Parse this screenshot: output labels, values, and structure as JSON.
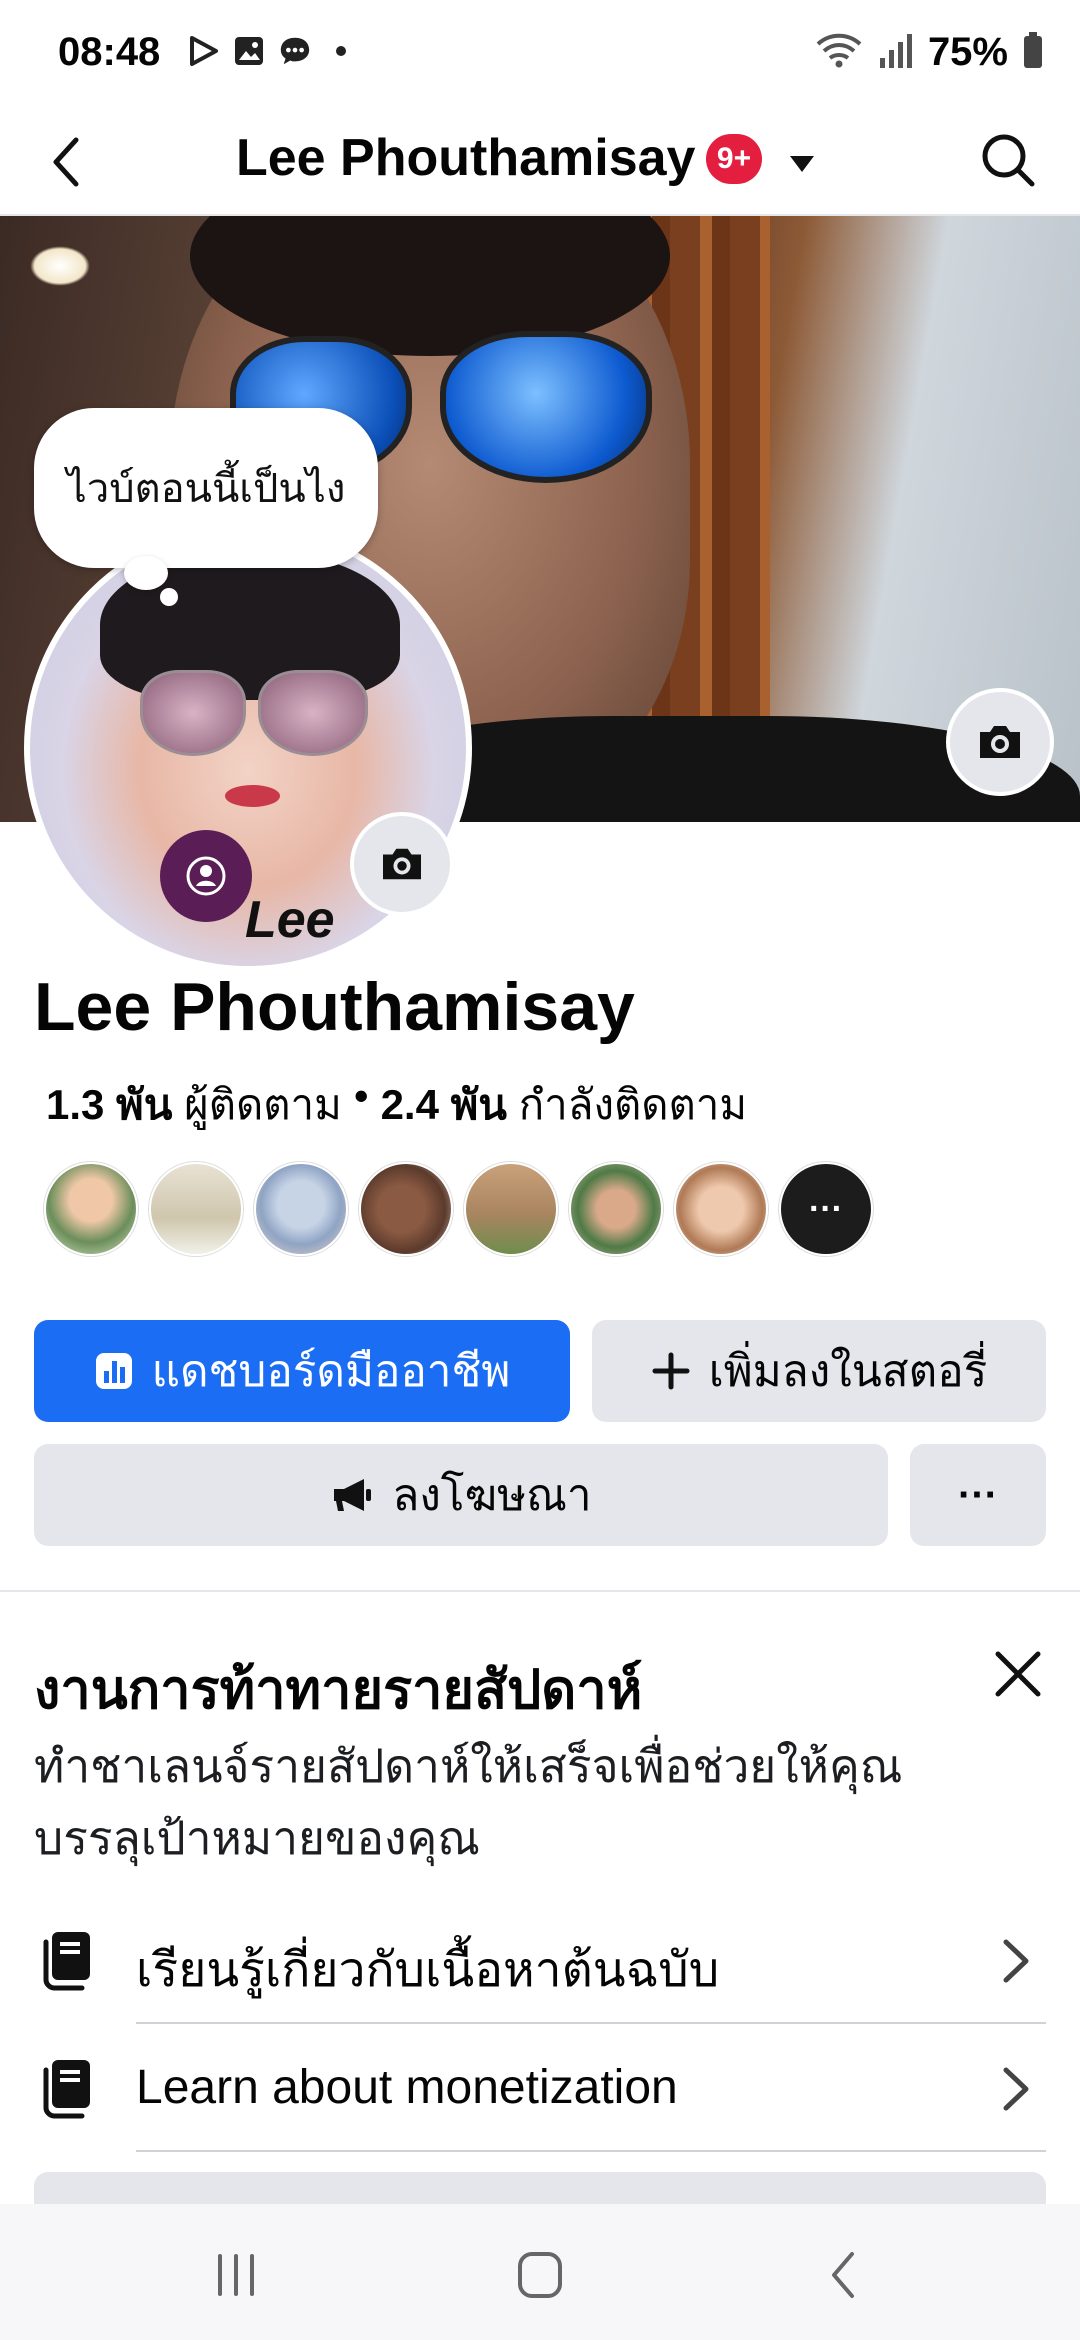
{
  "status_bar": {
    "time": "08:48",
    "left_icons": [
      "play-icon",
      "image-icon",
      "chat-icon",
      "dot-icon"
    ],
    "right_icons": [
      "wifi-icon",
      "signal-icon",
      "battery-icon"
    ],
    "battery": "75%"
  },
  "header": {
    "title": "Lee Phouthamisay",
    "badge": "9+",
    "icons": [
      "back-icon",
      "caret-down-icon",
      "search-icon"
    ]
  },
  "profile": {
    "thought_bubble": "ไวบ์ตอนนี้เป็นไง",
    "avatar_text": "Lee",
    "name": "Lee Phouthamisay",
    "followers_count": "1.3 พัน",
    "followers_label": "ผู้ติดตาม",
    "separator": "•",
    "following_count": "2.4 พัน",
    "following_label": "กำลังติดตาม",
    "friends_more": "···"
  },
  "buttons": {
    "dashboard": "แดชบอร์ดมืออาชีพ",
    "add_story": "เพิ่มลงในสตอรี่",
    "advertise": "ลงโฆษณา",
    "more": "···"
  },
  "challenge": {
    "title": "งานการท้าทายรายสัปดาห์",
    "description": "ทำชาเลนจ์รายสัปดาห์ให้เสร็จเพื่อช่วยให้คุณบรรลุเป้าหมายของคุณ",
    "items": [
      {
        "label": "เรียนรู้เกี่ยวกับเนื้อหาต้นฉบับ",
        "icon": "book-icon"
      },
      {
        "label": "Learn about monetization",
        "icon": "book-icon"
      }
    ]
  },
  "colors": {
    "primary": "#1b6ef3",
    "badge": "#e41e3f",
    "button_gray": "#e4e6eb"
  }
}
